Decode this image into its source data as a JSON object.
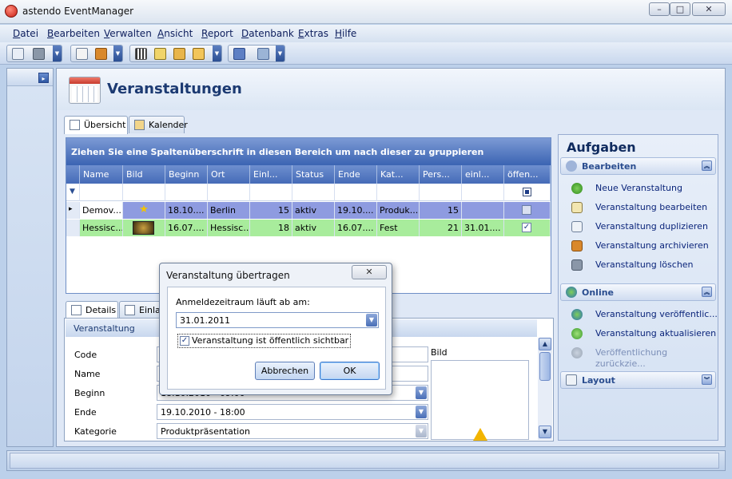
{
  "window": {
    "title": "astendo EventManager",
    "minimize": "–",
    "maximize": "□",
    "close": "✕"
  },
  "menu": [
    {
      "key": "D",
      "rest": "atei"
    },
    {
      "key": "B",
      "rest": "earbeiten"
    },
    {
      "key": "V",
      "rest": "erwalten"
    },
    {
      "key": "A",
      "rest": "nsicht"
    },
    {
      "key": "R",
      "rest": "eport"
    },
    {
      "key": "D",
      "rest": "atenbank"
    },
    {
      "key": "E",
      "rest": "xtras"
    },
    {
      "key": "H",
      "rest": "ilfe"
    }
  ],
  "page": {
    "title": "Veranstaltungen"
  },
  "view_tabs": [
    {
      "label": "Übersicht"
    },
    {
      "label": "Kalender"
    }
  ],
  "grid": {
    "group_hint": "Ziehen Sie eine Spaltenüberschrift in diesen Bereich um nach dieser zu gruppieren",
    "columns": [
      "Name",
      "Bild",
      "Beginn",
      "Ort",
      "Einl...",
      "Status",
      "Ende",
      "Kat...",
      "Pers...",
      "einl...",
      "öffen..."
    ],
    "rows": [
      {
        "name": "Demov...",
        "bild": "★",
        "beginn": "18.10....",
        "ort": "Berlin",
        "einl": "15",
        "status": "aktiv",
        "ende": "19.10....",
        "kat": "Produk...",
        "pers": "15",
        "einl2": "",
        "offen": ""
      },
      {
        "name": "Hessisc...",
        "bild": "",
        "beginn": "16.07....",
        "ort": "Hessisc...",
        "einl": "18",
        "status": "aktiv",
        "ende": "16.07....",
        "kat": "Fest",
        "pers": "21",
        "einl2": "31.01....",
        "offen": "✓"
      }
    ],
    "filter_mark": "▼",
    "row_marker": "▸"
  },
  "detail_tabs": [
    {
      "label": "Details"
    },
    {
      "label": "Einlad"
    }
  ],
  "detail": {
    "section": "Veranstaltung",
    "fields": [
      {
        "label": "Code",
        "value": ""
      },
      {
        "label": "Name",
        "value": ""
      },
      {
        "label": "Beginn",
        "value": "18.10.2010 - 09:00"
      },
      {
        "label": "Ende",
        "value": "19.10.2010 - 18:00"
      },
      {
        "label": "Kategorie",
        "value": "Produktpräsentation"
      }
    ],
    "image_label": "Bild"
  },
  "tasks": {
    "title": "Aufgaben",
    "groups": [
      {
        "title": "Bearbeiten",
        "items": [
          "Neue Veranstaltung",
          "Veranstaltung bearbeiten",
          "Veranstaltung duplizieren",
          "Veranstaltung archivieren",
          "Veranstaltung löschen"
        ]
      },
      {
        "title": "Online",
        "items": [
          "Veranstaltung veröffentlic...",
          "Veranstaltung aktualisieren",
          "Veröffentlichung zurückzie..."
        ]
      },
      {
        "title": "Layout",
        "items": []
      }
    ]
  },
  "dialog": {
    "title": "Veranstaltung übertragen",
    "close": "✕",
    "date_label": "Anmeldezeitraum läuft ab am:",
    "date_value": "31.01.2011",
    "checkbox_label": "Veranstaltung ist öffentlich sichtbar",
    "checkbox_mark": "✓",
    "cancel": "Abbrechen",
    "ok": "OK"
  },
  "icons": {
    "expand": "▸",
    "collapse_up": "︽",
    "collapse_down": "︾",
    "dropdown": "▼",
    "scroll_up": "▲",
    "scroll_down": "▼"
  },
  "colors": {
    "accent": "#3b64b3",
    "row_selected": "#8e9be0",
    "row_highlight": "#a8ec9c",
    "title": "#1c3a72"
  }
}
